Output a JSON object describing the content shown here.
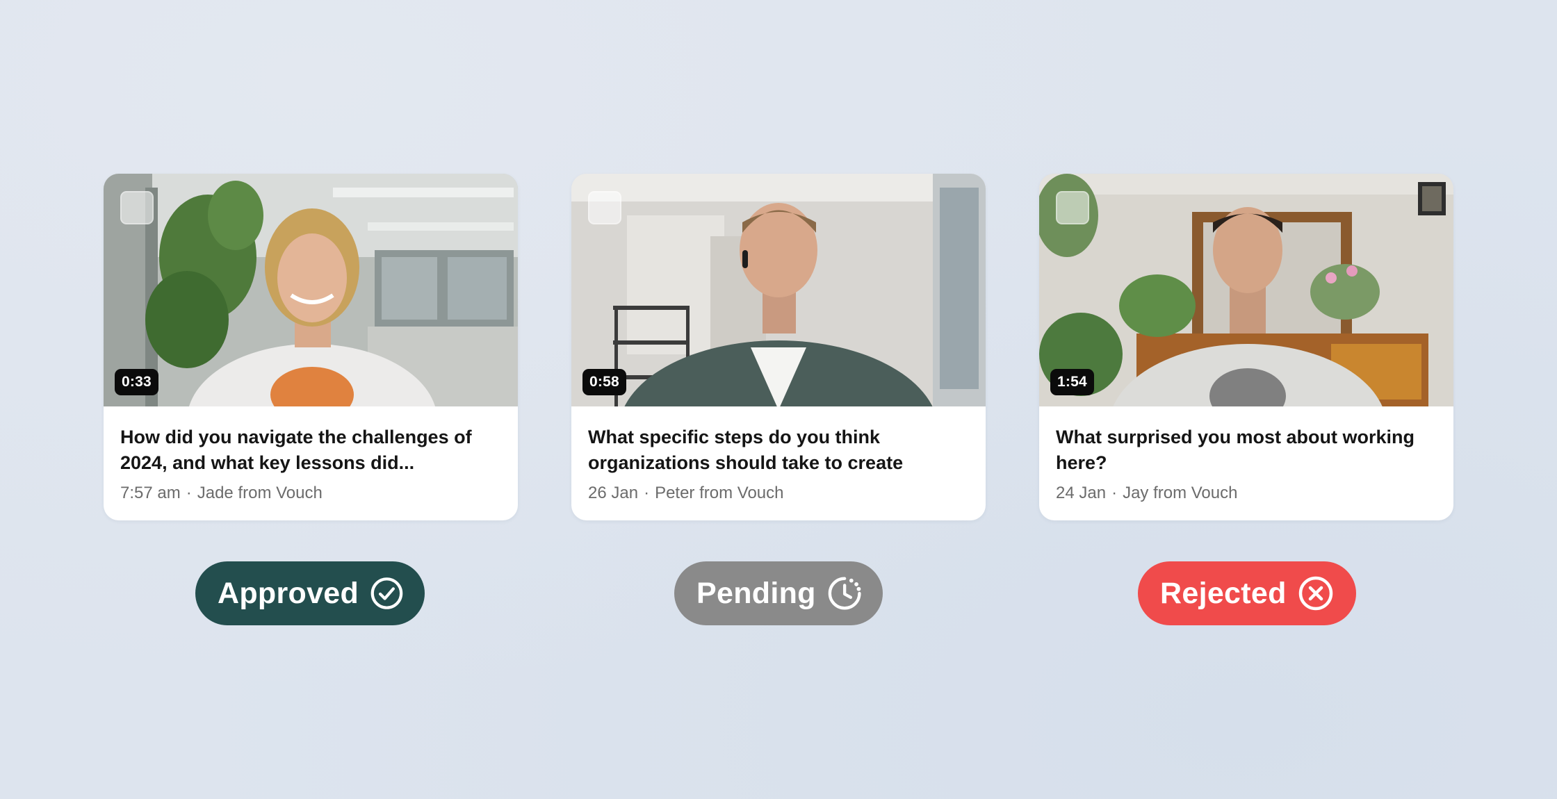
{
  "cards": [
    {
      "duration": "0:33",
      "title": "How did you navigate the challenges of 2024, and what key lessons did...",
      "time": "7:57 am",
      "author": "Jade from Vouch"
    },
    {
      "duration": "0:58",
      "title": "What specific steps do you think organizations should take to create",
      "time": "26 Jan",
      "author": "Peter from Vouch"
    },
    {
      "duration": "1:54",
      "title": "What surprised you most about working here?",
      "time": "24 Jan",
      "author": "Jay from Vouch"
    }
  ],
  "statuses": [
    {
      "label": "Approved",
      "icon": "check-circle-icon",
      "color": "#234e4e"
    },
    {
      "label": "Pending",
      "icon": "clock-pending-icon",
      "color": "#8a8a8a"
    },
    {
      "label": "Rejected",
      "icon": "x-circle-icon",
      "color": "#f04b4b"
    }
  ],
  "meta_separator": "·"
}
